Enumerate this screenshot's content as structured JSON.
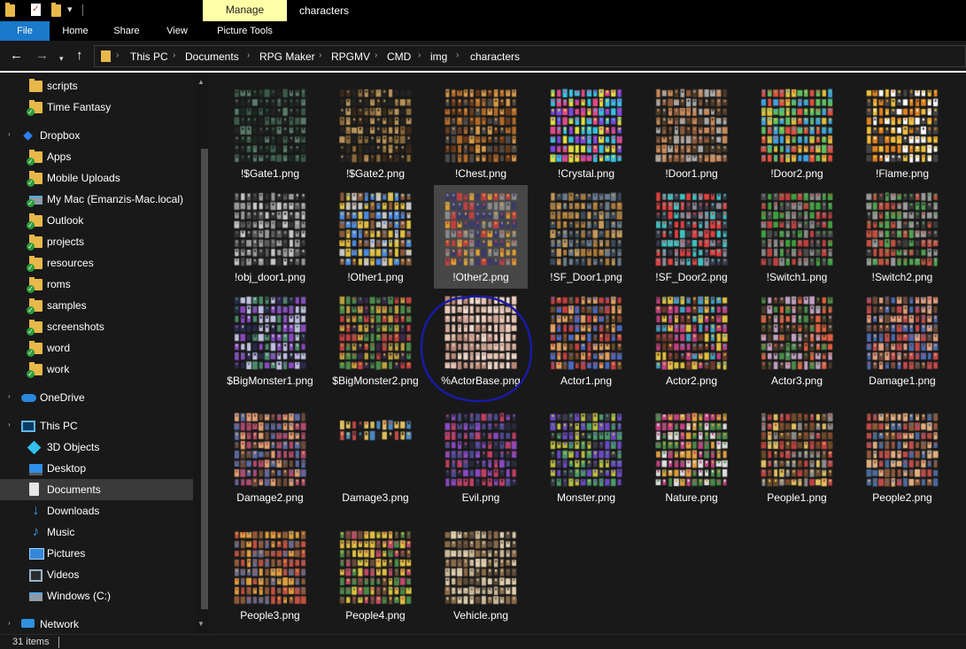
{
  "window": {
    "title": "characters"
  },
  "ribbon": {
    "manage_label": "Manage",
    "tabs": [
      "File",
      "Home",
      "Share",
      "View",
      "Picture Tools"
    ]
  },
  "address": {
    "path": [
      "This PC",
      "Documents",
      "RPG Maker",
      "RPGMV",
      "CMD",
      "img",
      "characters"
    ]
  },
  "nav": {
    "items": [
      {
        "label": "scripts",
        "icon": "folder-icon"
      },
      {
        "label": "Time Fantasy",
        "icon": "synced-folder-icon"
      },
      {
        "label": "Dropbox",
        "icon": "dropbox-icon"
      },
      {
        "label": "Apps",
        "icon": "synced-folder-icon"
      },
      {
        "label": "Mobile Uploads",
        "icon": "synced-folder-icon"
      },
      {
        "label": "My Mac (Emanzis-Mac.local)",
        "icon": "synced-drive-icon"
      },
      {
        "label": "Outlook",
        "icon": "synced-folder-icon"
      },
      {
        "label": "projects",
        "icon": "synced-folder-icon"
      },
      {
        "label": "resources",
        "icon": "synced-folder-icon"
      },
      {
        "label": "roms",
        "icon": "synced-folder-icon"
      },
      {
        "label": "samples",
        "icon": "synced-folder-icon"
      },
      {
        "label": "screenshots",
        "icon": "synced-folder-icon"
      },
      {
        "label": "word",
        "icon": "synced-folder-icon"
      },
      {
        "label": "work",
        "icon": "synced-folder-icon"
      },
      {
        "label": "OneDrive",
        "icon": "onedrive-cloud-icon"
      },
      {
        "label": "This PC",
        "icon": "this-pc-icon"
      },
      {
        "label": "3D Objects",
        "icon": "3d-objects-icon"
      },
      {
        "label": "Desktop",
        "icon": "desktop-icon"
      },
      {
        "label": "Documents",
        "icon": "documents-icon",
        "selected": true
      },
      {
        "label": "Downloads",
        "icon": "downloads-icon"
      },
      {
        "label": "Music",
        "icon": "music-icon"
      },
      {
        "label": "Pictures",
        "icon": "pictures-icon"
      },
      {
        "label": "Videos",
        "icon": "videos-icon"
      },
      {
        "label": "Windows (C:)",
        "icon": "drive-icon"
      },
      {
        "label": "Network",
        "icon": "network-icon"
      }
    ]
  },
  "files": [
    {
      "name": "!$Gate1.png",
      "palette": [
        "#3a5a4a",
        "#1c2a22",
        "#5a7a6a",
        "#222"
      ]
    },
    {
      "name": "!$Gate2.png",
      "palette": [
        "#8a6a3a",
        "#3a2a1a",
        "#b8935a",
        "#222"
      ]
    },
    {
      "name": "!Chest.png",
      "palette": [
        "#b06a2a",
        "#6a3a1a",
        "#d89a4a",
        "#4a4a4a"
      ]
    },
    {
      "name": "!Crystal.png",
      "palette": [
        "#e04a8a",
        "#3ac0e0",
        "#e0e040",
        "#7a4ae0"
      ]
    },
    {
      "name": "!Door1.png",
      "palette": [
        "#8a5a3a",
        "#c88a5a",
        "#4a3a2a",
        "#aaa"
      ]
    },
    {
      "name": "!Door2.png",
      "palette": [
        "#e0c040",
        "#40a0e0",
        "#e05040",
        "#60c060"
      ]
    },
    {
      "name": "!Flame.png",
      "palette": [
        "#e08020",
        "#f0c040",
        "#fff",
        "#444"
      ]
    },
    {
      "name": "!obj_door1.png",
      "palette": [
        "#9a9a9a",
        "#5a5a5a",
        "#c8c8c8",
        "#333"
      ]
    },
    {
      "name": "!Other1.png",
      "palette": [
        "#c8c8c8",
        "#8a5a3a",
        "#4a8ae0",
        "#e0c040"
      ]
    },
    {
      "name": "!Other2.png",
      "palette": [
        "#e0a030",
        "#8a8a8a",
        "#3a3a6a",
        "#c04040"
      ],
      "hover": true
    },
    {
      "name": "!SF_Door1.png",
      "palette": [
        "#6a7a8a",
        "#aa7a3a",
        "#3a4a5a",
        "#c89a5a"
      ]
    },
    {
      "name": "!SF_Door2.png",
      "palette": [
        "#e04040",
        "#40c0c0",
        "#8a8a9a",
        "#3a3a4a"
      ]
    },
    {
      "name": "!Switch1.png",
      "palette": [
        "#8a8a8a",
        "#c04040",
        "#40a040",
        "#4a4a4a"
      ]
    },
    {
      "name": "!Switch2.png",
      "palette": [
        "#9a9a9a",
        "#c05040",
        "#50a050",
        "#3a3a3a"
      ]
    },
    {
      "name": "$BigMonster1.png",
      "palette": [
        "#4a8a6a",
        "#8a4ac0",
        "#c0c0e0",
        "#2a2a4a"
      ]
    },
    {
      "name": "$BigMonster2.png",
      "palette": [
        "#c0a040",
        "#c04040",
        "#4a8a4a",
        "#3a2a4a"
      ]
    },
    {
      "name": "%ActorBase.png",
      "palette": [
        "#e8c8b8",
        "#d0a898",
        "#f0dcd0",
        "#b88878"
      ]
    },
    {
      "name": "Actor1.png",
      "palette": [
        "#c04040",
        "#e0a060",
        "#4a6ac0",
        "#6a4a2a"
      ]
    },
    {
      "name": "Actor2.png",
      "palette": [
        "#e0c040",
        "#c04080",
        "#40a0c0",
        "#6a3a2a"
      ]
    },
    {
      "name": "Actor3.png",
      "palette": [
        "#c0a0c0",
        "#e06040",
        "#4a8a4a",
        "#4a3a2a"
      ]
    },
    {
      "name": "Damage1.png",
      "palette": [
        "#c04a4a",
        "#e0a080",
        "#4a6ab0",
        "#6a4a3a"
      ]
    },
    {
      "name": "Damage2.png",
      "palette": [
        "#b04a6a",
        "#e0a070",
        "#5a6aa0",
        "#6a4a3a"
      ]
    },
    {
      "name": "Damage3.png",
      "palette": [
        "#c04a4a",
        "#4a8ac0",
        "#e0c060",
        "#222"
      ],
      "short": true
    },
    {
      "name": "Evil.png",
      "palette": [
        "#8a4ac0",
        "#c04060",
        "#4a4a8a",
        "#2a2a3a"
      ]
    },
    {
      "name": "Monster.png",
      "palette": [
        "#6a4ac0",
        "#4a9a6a",
        "#c0c040",
        "#3a3a4a"
      ]
    },
    {
      "name": "Nature.png",
      "palette": [
        "#e0e0e0",
        "#c04080",
        "#e0a040",
        "#4a8a4a"
      ]
    },
    {
      "name": "People1.png",
      "palette": [
        "#e0c060",
        "#c04040",
        "#6a4a2a",
        "#8a8a8a"
      ]
    },
    {
      "name": "People2.png",
      "palette": [
        "#c04a4a",
        "#e0b080",
        "#8a5a3a",
        "#4a6a9a"
      ]
    },
    {
      "name": "People3.png",
      "palette": [
        "#e0a040",
        "#c05040",
        "#8a5a3a",
        "#6a6a8a"
      ]
    },
    {
      "name": "People4.png",
      "palette": [
        "#e0c040",
        "#c04a6a",
        "#4a8a4a",
        "#6a4a3a"
      ]
    },
    {
      "name": "Vehicle.png",
      "palette": [
        "#c8b89a",
        "#8a6a4a",
        "#e0d0b0",
        "#5a4a3a"
      ]
    }
  ],
  "status": {
    "item_count": "31 items"
  },
  "annotation": {
    "color": "#1a1aa8"
  },
  "colors": {
    "accent": "#1979ca",
    "manage": "#ffffa8",
    "folder": "#e8b84a"
  }
}
